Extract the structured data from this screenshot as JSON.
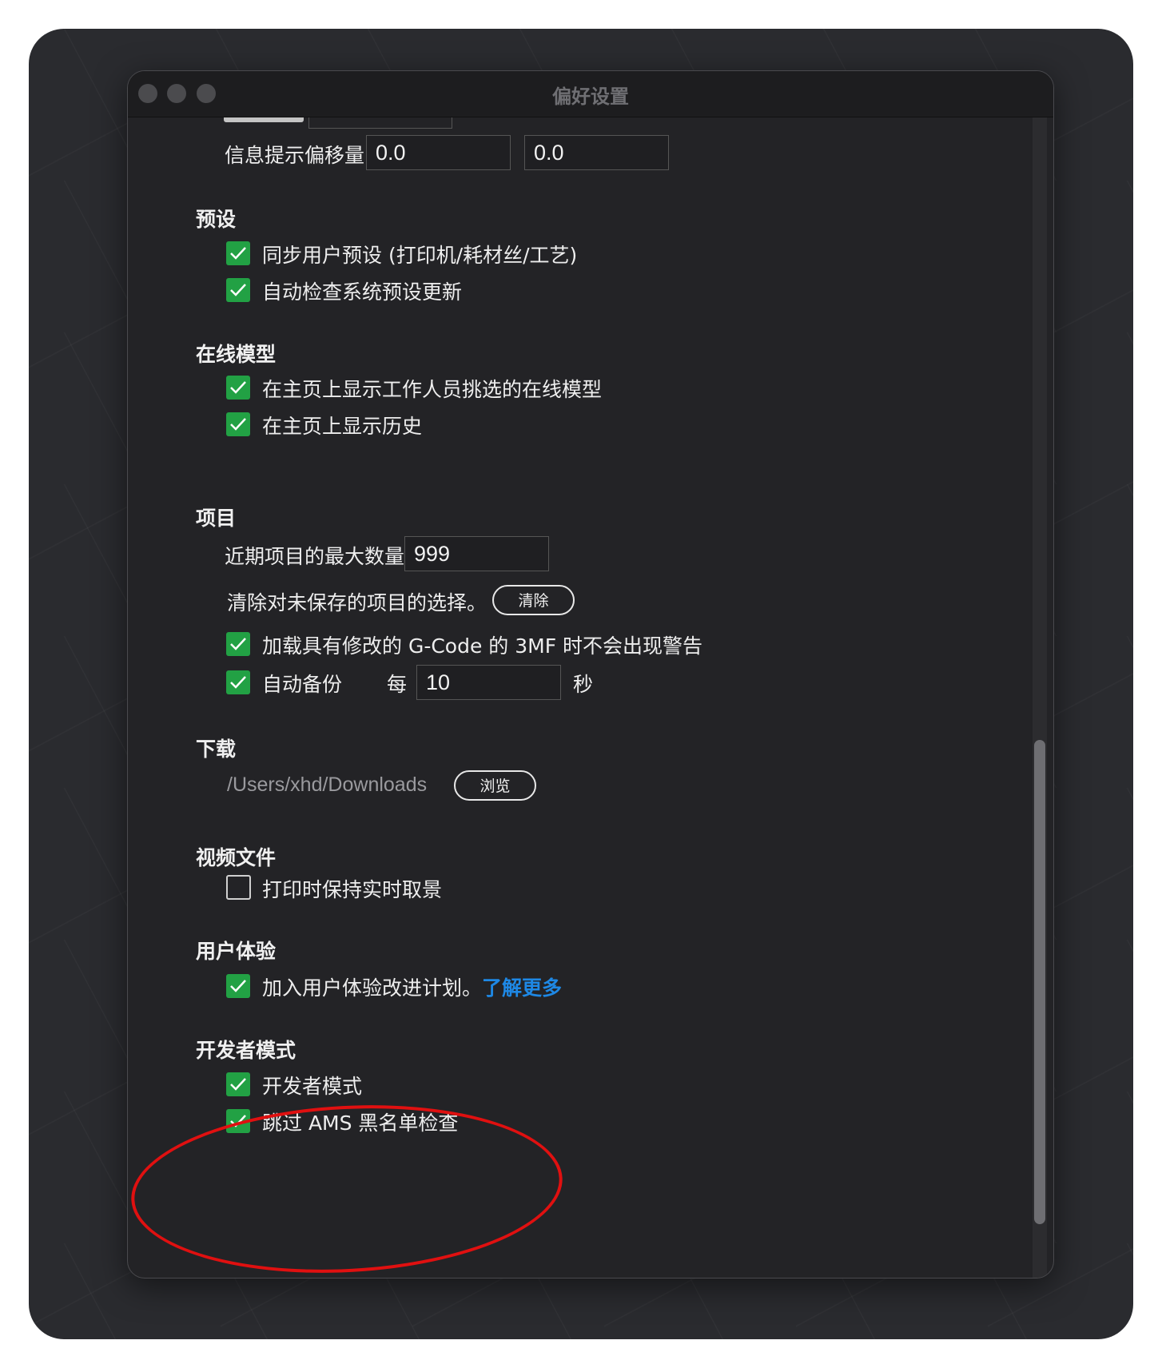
{
  "window": {
    "title": "偏好设置"
  },
  "colors": {
    "accent_green": "#22a144",
    "link_blue": "#1e88e5",
    "annotation_red": "#e01010"
  },
  "info_offset": {
    "label": "信息提示偏移量",
    "x": "0.0",
    "y": "0.0"
  },
  "presets": {
    "title": "预设",
    "sync_user_presets": {
      "label": "同步用户预设 (打印机/耗材丝/工艺)",
      "checked": true
    },
    "auto_check_updates": {
      "label": "自动检查系统预设更新",
      "checked": true
    }
  },
  "online_models": {
    "title": "在线模型",
    "show_staff_picks": {
      "label": "在主页上显示工作人员挑选的在线模型",
      "checked": true
    },
    "show_history": {
      "label": "在主页上显示历史",
      "checked": true
    }
  },
  "projects": {
    "title": "项目",
    "max_recent_label": "近期项目的最大数量",
    "max_recent_value": "999",
    "clear_label": "清除对未保存的项目的选择。",
    "clear_button": "清除",
    "no_gcode_warning": {
      "label": "加载具有修改的 G-Code 的 3MF 时不会出现警告",
      "checked": true
    },
    "auto_backup": {
      "label": "自动备份",
      "checked": true,
      "every_label": "每",
      "interval": "10",
      "unit": "秒"
    }
  },
  "download": {
    "title": "下载",
    "path": "/Users/xhd/Downloads",
    "browse_button": "浏览"
  },
  "video": {
    "title": "视频文件",
    "keep_liveview": {
      "label": "打印时保持实时取景",
      "checked": false
    }
  },
  "user_experience": {
    "title": "用户体验",
    "join_program": {
      "label": "加入用户体验改进计划。",
      "checked": true
    },
    "learn_more": "了解更多"
  },
  "developer": {
    "title": "开发者模式",
    "dev_mode": {
      "label": "开发者模式",
      "checked": true
    },
    "skip_ams_blacklist": {
      "label": "跳过 AMS 黑名单检查",
      "checked": true
    }
  },
  "scrollbar": {
    "position": 0.57
  }
}
